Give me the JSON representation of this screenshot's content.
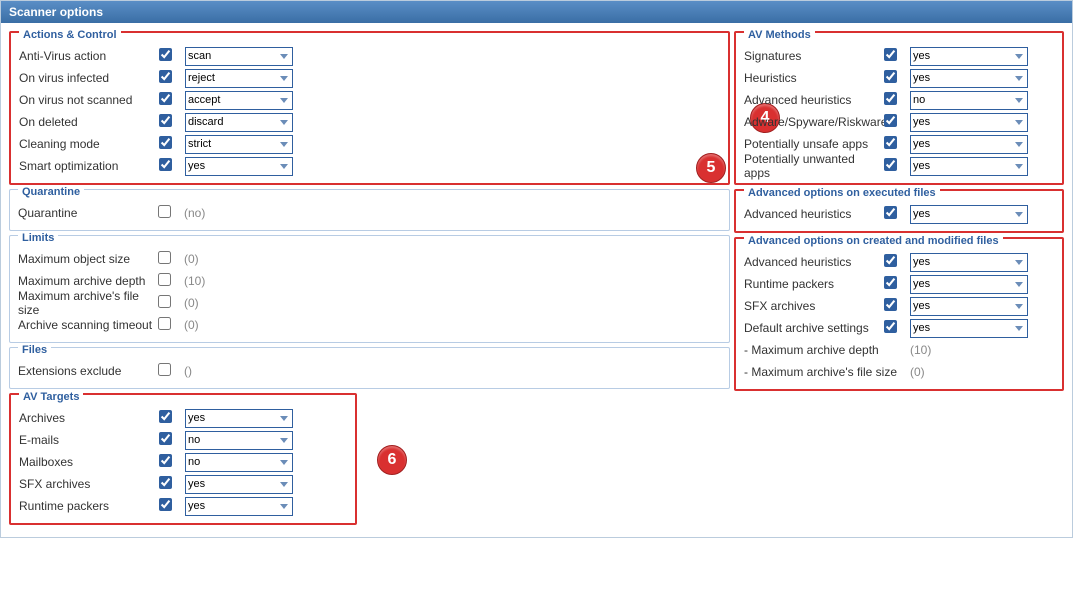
{
  "header": {
    "title": "Scanner options"
  },
  "badges": {
    "four": "4",
    "five": "5",
    "six": "6"
  },
  "actions": {
    "legend": "Actions & Control",
    "items": [
      {
        "label": "Anti-Virus action",
        "checked": true,
        "value": "scan"
      },
      {
        "label": "On virus infected",
        "checked": true,
        "value": "reject"
      },
      {
        "label": "On virus not scanned",
        "checked": true,
        "value": "accept"
      },
      {
        "label": "On deleted",
        "checked": true,
        "value": "discard"
      },
      {
        "label": "Cleaning mode",
        "checked": true,
        "value": "strict"
      },
      {
        "label": "Smart optimization",
        "checked": true,
        "value": "yes"
      }
    ]
  },
  "quarantine": {
    "legend": "Quarantine",
    "items": [
      {
        "label": "Quarantine",
        "checked": false,
        "text": "(no)"
      }
    ]
  },
  "limits": {
    "legend": "Limits",
    "items": [
      {
        "label": "Maximum object size",
        "checked": false,
        "text": "(0)"
      },
      {
        "label": "Maximum archive depth",
        "checked": false,
        "text": "(10)"
      },
      {
        "label": "Maximum archive's file size",
        "checked": false,
        "text": "(0)"
      },
      {
        "label": "Archive scanning timeout",
        "checked": false,
        "text": "(0)"
      }
    ]
  },
  "files": {
    "legend": "Files",
    "items": [
      {
        "label": "Extensions exclude",
        "checked": false,
        "text": "()"
      }
    ]
  },
  "targets": {
    "legend": "AV Targets",
    "items": [
      {
        "label": "Archives",
        "checked": true,
        "value": "yes"
      },
      {
        "label": "E-mails",
        "checked": true,
        "value": "no"
      },
      {
        "label": "Mailboxes",
        "checked": true,
        "value": "no"
      },
      {
        "label": "SFX archives",
        "checked": true,
        "value": "yes"
      },
      {
        "label": "Runtime packers",
        "checked": true,
        "value": "yes"
      }
    ]
  },
  "methods": {
    "legend": "AV Methods",
    "items": [
      {
        "label": "Signatures",
        "checked": true,
        "value": "yes"
      },
      {
        "label": "Heuristics",
        "checked": true,
        "value": "yes"
      },
      {
        "label": "Advanced heuristics",
        "checked": true,
        "value": "no"
      },
      {
        "label": "Adware/Spyware/Riskware",
        "checked": true,
        "value": "yes"
      },
      {
        "label": "Potentially unsafe apps",
        "checked": true,
        "value": "yes"
      },
      {
        "label": "Potentially unwanted apps",
        "checked": true,
        "value": "yes"
      }
    ]
  },
  "advExec": {
    "legend": "Advanced options on executed files",
    "items": [
      {
        "label": "Advanced heuristics",
        "checked": true,
        "value": "yes"
      }
    ]
  },
  "advCreated": {
    "legend": "Advanced options on created and modified files",
    "items": [
      {
        "label": "Advanced heuristics",
        "checked": true,
        "value": "yes"
      },
      {
        "label": "Runtime packers",
        "checked": true,
        "value": "yes"
      },
      {
        "label": "SFX archives",
        "checked": true,
        "value": "yes"
      },
      {
        "label": "Default archive settings",
        "checked": true,
        "value": "yes"
      }
    ],
    "sub": [
      {
        "label": " - Maximum archive depth",
        "text": "(10)"
      },
      {
        "label": " - Maximum archive's file size",
        "text": "(0)"
      }
    ]
  }
}
